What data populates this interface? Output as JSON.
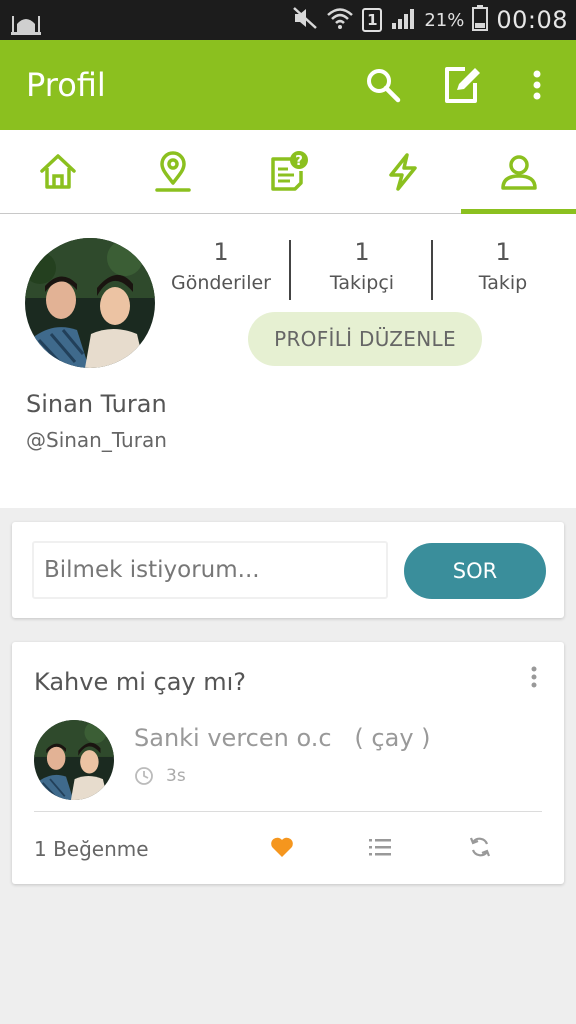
{
  "status_bar": {
    "battery": "21%",
    "time": "00:08",
    "sim_slot": "1"
  },
  "app_bar": {
    "title": "Profil"
  },
  "colors": {
    "brand_green": "#8bc01f",
    "sor_teal": "#3a8e9b",
    "like_orange": "#f5961e"
  },
  "tabs": [
    {
      "icon": "home-icon"
    },
    {
      "icon": "location-pin-icon"
    },
    {
      "icon": "question-list-icon"
    },
    {
      "icon": "lightning-icon"
    },
    {
      "icon": "profile-icon",
      "active": true
    }
  ],
  "profile": {
    "stats": [
      {
        "count": "1",
        "label": "Gönderiler"
      },
      {
        "count": "1",
        "label": "Takipçi"
      },
      {
        "count": "1",
        "label": "Takip"
      }
    ],
    "edit_label": "PROFİLİ DÜZENLE",
    "name": "Sinan Turan",
    "handle": "@Sinan_Turan"
  },
  "ask": {
    "placeholder": "Bilmek istiyorum...",
    "button": "SOR"
  },
  "post": {
    "question": "Kahve mi çay mı?",
    "answer": "Sanki vercen o.c   ( çay )",
    "time": "3s",
    "likes": "1 Beğenme"
  }
}
